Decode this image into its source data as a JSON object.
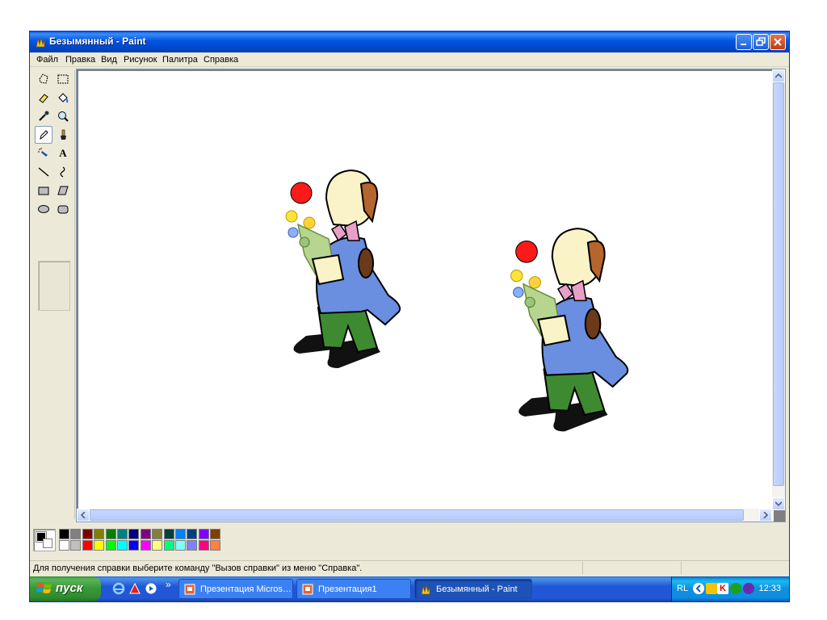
{
  "window": {
    "title": "Безымянный - Paint"
  },
  "menu": [
    "Файл",
    "Правка",
    "Вид",
    "Рисунок",
    "Палитра",
    "Справка"
  ],
  "tools": [
    {
      "name": "free-select-icon"
    },
    {
      "name": "rect-select-icon"
    },
    {
      "name": "eraser-icon"
    },
    {
      "name": "fill-icon"
    },
    {
      "name": "eyedropper-icon"
    },
    {
      "name": "magnifier-icon"
    },
    {
      "name": "pencil-icon",
      "active": true
    },
    {
      "name": "brush-icon"
    },
    {
      "name": "airbrush-icon"
    },
    {
      "name": "text-icon",
      "glyph": "A"
    },
    {
      "name": "line-icon"
    },
    {
      "name": "curve-icon"
    },
    {
      "name": "rectangle-icon"
    },
    {
      "name": "polygon-icon"
    },
    {
      "name": "ellipse-icon"
    },
    {
      "name": "rounded-rect-icon"
    }
  ],
  "palette": {
    "foreground": "#000000",
    "background": "#ffffff",
    "top_row": [
      "#000000",
      "#808080",
      "#800000",
      "#808000",
      "#008000",
      "#008080",
      "#000080",
      "#800080",
      "#808040",
      "#004040",
      "#0080ff",
      "#004080",
      "#8000ff",
      "#804000"
    ],
    "bottom_row": [
      "#ffffff",
      "#c0c0c0",
      "#ff0000",
      "#ffff00",
      "#00ff00",
      "#00ffff",
      "#0000ff",
      "#ff00ff",
      "#ffff80",
      "#00ff80",
      "#80ffff",
      "#8080ff",
      "#ff0080",
      "#ff8040"
    ]
  },
  "status": {
    "text": "Для получения справки выберите команду \"Вызов справки\" из меню \"Справка\"."
  },
  "taskbar": {
    "start_label": "пуск",
    "quicklaunch_more": "»",
    "tasks": [
      {
        "label": "Презентация Micros…",
        "active": false
      },
      {
        "label": "Презентация1",
        "active": false
      },
      {
        "label": "Безымянный - Paint",
        "active": true
      }
    ],
    "tray_lang": "RL",
    "clock": "12:33"
  },
  "colors": {
    "titlebar": "#0054e3",
    "start_green": "#3a9a3a",
    "taskbar_blue": "#2157d7",
    "window_face": "#ece9d8"
  }
}
